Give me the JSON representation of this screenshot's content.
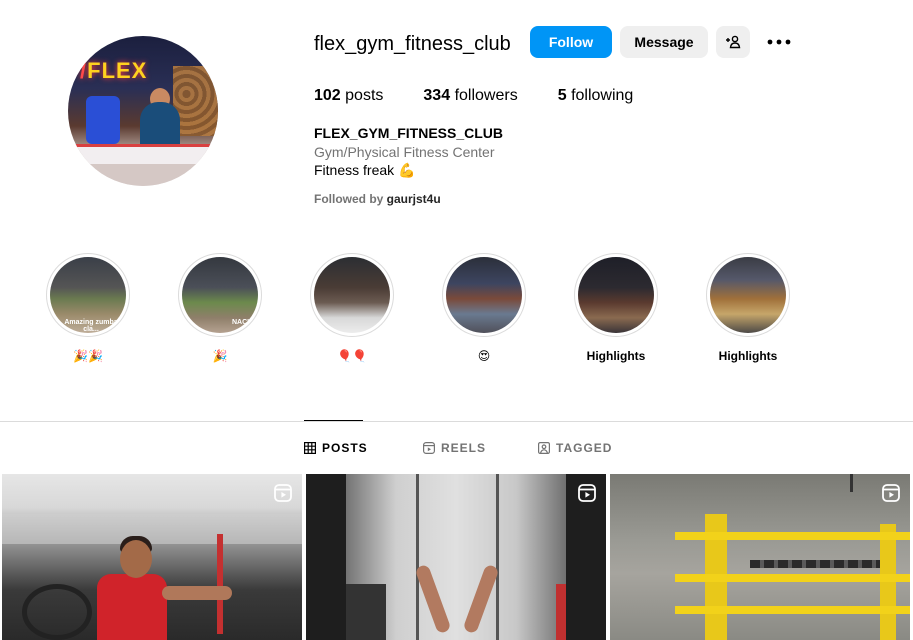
{
  "profile": {
    "username": "flex_gym_fitness_club",
    "follow_label": "Follow",
    "message_label": "Message",
    "stats": {
      "posts_count": "102",
      "posts_label": "posts",
      "followers_count": "334",
      "followers_label": "followers",
      "following_count": "5",
      "following_label": "following"
    },
    "full_name": "FLEX_GYM_FITNESS_CLUB",
    "category": "Gym/Physical Fitness Center",
    "bio": "Fitness freak 💪",
    "followed_by_prefix": "Followed by ",
    "followed_by_user": "gaurjst4u",
    "avatar_text": "FLEX"
  },
  "highlights": [
    {
      "label": "🎉🎉",
      "caption": "Amazing zumba cla..."
    },
    {
      "label": "🎉",
      "caption": "NACH"
    },
    {
      "label": "🎈🎈",
      "caption": ""
    },
    {
      "label": "😍",
      "caption": ""
    },
    {
      "label": "Highlights",
      "caption": ""
    },
    {
      "label": "Highlights",
      "caption": ""
    }
  ],
  "tabs": [
    {
      "label": "POSTS",
      "icon": "grid-icon",
      "active": true
    },
    {
      "label": "REELS",
      "icon": "reels-icon",
      "active": false
    },
    {
      "label": "TAGGED",
      "icon": "tagged-icon",
      "active": false
    }
  ],
  "posts": [
    {
      "type": "reel",
      "icon": "reel-icon"
    },
    {
      "type": "reel",
      "icon": "reel-icon"
    },
    {
      "type": "reel",
      "icon": "reel-icon"
    }
  ],
  "colors": {
    "accent": "#0095f6",
    "secondary_button": "#efefef",
    "muted_text": "#737373",
    "divider": "#dbdbdb"
  }
}
